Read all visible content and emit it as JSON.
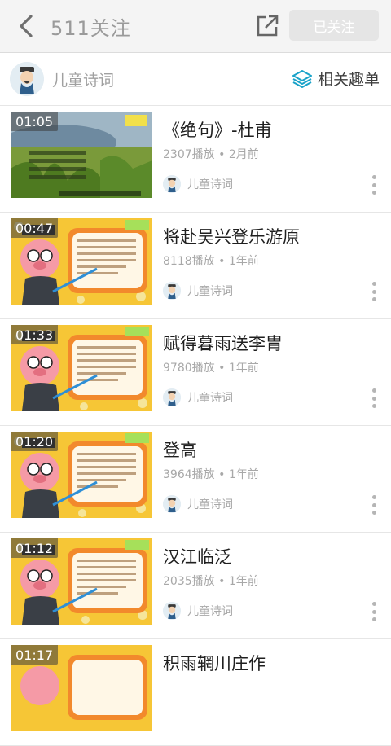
{
  "header": {
    "title": "511关注",
    "follow_label": "已关注",
    "back_icon": "chevron-left-icon",
    "share_icon": "share-external-icon"
  },
  "channel": {
    "name": "儿童诗词",
    "related_label": "相关趣单",
    "related_icon": "layers-icon",
    "accent": "#1aa3c9"
  },
  "videos": [
    {
      "title": "《绝句》-杜甫",
      "duration": "01:05",
      "plays": "2307播放",
      "age": "2月前",
      "author": "儿童诗词"
    },
    {
      "title": "将赴吴兴登乐游原",
      "duration": "00:47",
      "plays": "8118播放",
      "age": "1年前",
      "author": "儿童诗词"
    },
    {
      "title": "赋得暮雨送李胄",
      "duration": "01:33",
      "plays": "9780播放",
      "age": "1年前",
      "author": "儿童诗词"
    },
    {
      "title": "登高",
      "duration": "01:20",
      "plays": "3964播放",
      "age": "1年前",
      "author": "儿童诗词"
    },
    {
      "title": "汉江临泛",
      "duration": "01:12",
      "plays": "2035播放",
      "age": "1年前",
      "author": "儿童诗词"
    },
    {
      "title": "积雨辋川庄作",
      "duration": "01:17",
      "plays": "",
      "age": "",
      "author": ""
    }
  ],
  "meta_separator": " • "
}
